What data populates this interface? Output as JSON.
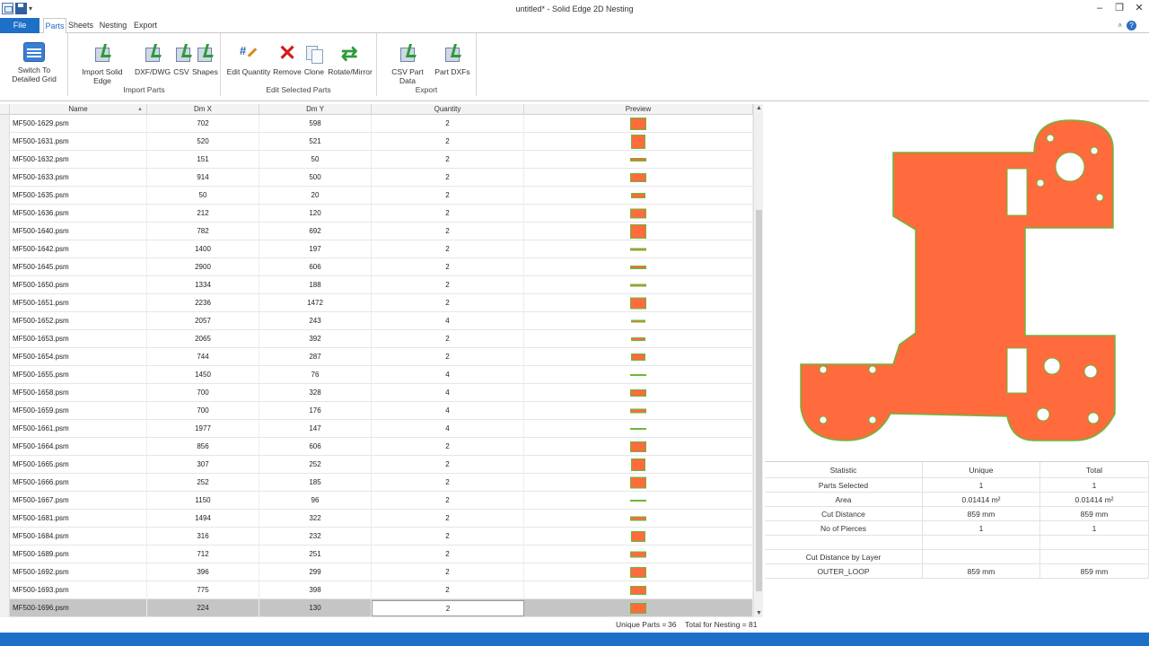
{
  "window": {
    "title": "untitled* - Solid Edge 2D Nesting",
    "minimize": "–",
    "maximize": "❐",
    "close": "✕"
  },
  "tabs": [
    {
      "label": "File"
    },
    {
      "label": "Parts"
    },
    {
      "label": "Sheets"
    },
    {
      "label": "Nesting"
    },
    {
      "label": "Export"
    }
  ],
  "help": "?",
  "collapse": "˄",
  "ribbon": {
    "groups": [
      {
        "label": "",
        "buttons": [
          {
            "label": "Switch To Detailed Grid"
          }
        ]
      },
      {
        "label": "Import Parts",
        "buttons": [
          {
            "label": "Import Solid Edge"
          },
          {
            "label": "DXF/DWG"
          },
          {
            "label": "CSV"
          },
          {
            "label": "Shapes"
          }
        ]
      },
      {
        "label": "Edit Selected Parts",
        "buttons": [
          {
            "label": "Edit Quantity"
          },
          {
            "label": "Remove"
          },
          {
            "label": "Clone"
          },
          {
            "label": "Rotate/Mirror"
          }
        ]
      },
      {
        "label": "Export",
        "buttons": [
          {
            "label": "CSV Part Data"
          },
          {
            "label": "Part DXFs"
          }
        ]
      }
    ]
  },
  "grid": {
    "columns": [
      "Name",
      "Dm X",
      "Dm Y",
      "Quantity",
      "Preview"
    ],
    "rows": [
      {
        "name": "MF500-1629.psm",
        "dx": "702",
        "dy": "598",
        "qty": "2"
      },
      {
        "name": "MF500-1631.psm",
        "dx": "520",
        "dy": "521",
        "qty": "2"
      },
      {
        "name": "MF500-1632.psm",
        "dx": "151",
        "dy": "50",
        "qty": "2"
      },
      {
        "name": "MF500-1633.psm",
        "dx": "914",
        "dy": "500",
        "qty": "2"
      },
      {
        "name": "MF500-1635.psm",
        "dx": "50",
        "dy": "20",
        "qty": "2"
      },
      {
        "name": "MF500-1636.psm",
        "dx": "212",
        "dy": "120",
        "qty": "2"
      },
      {
        "name": "MF500-1640.psm",
        "dx": "782",
        "dy": "692",
        "qty": "2"
      },
      {
        "name": "MF500-1642.psm",
        "dx": "1400",
        "dy": "197",
        "qty": "2"
      },
      {
        "name": "MF500-1645.psm",
        "dx": "2900",
        "dy": "606",
        "qty": "2"
      },
      {
        "name": "MF500-1650.psm",
        "dx": "1334",
        "dy": "188",
        "qty": "2"
      },
      {
        "name": "MF500-1651.psm",
        "dx": "2236",
        "dy": "1472",
        "qty": "2"
      },
      {
        "name": "MF500-1652.psm",
        "dx": "2057",
        "dy": "243",
        "qty": "4"
      },
      {
        "name": "MF500-1653.psm",
        "dx": "2065",
        "dy": "392",
        "qty": "2"
      },
      {
        "name": "MF500-1654.psm",
        "dx": "744",
        "dy": "287",
        "qty": "2"
      },
      {
        "name": "MF500-1655.psm",
        "dx": "1450",
        "dy": "76",
        "qty": "4"
      },
      {
        "name": "MF500-1658.psm",
        "dx": "700",
        "dy": "328",
        "qty": "4"
      },
      {
        "name": "MF500-1659.psm",
        "dx": "700",
        "dy": "176",
        "qty": "4"
      },
      {
        "name": "MF500-1661.psm",
        "dx": "1977",
        "dy": "147",
        "qty": "4"
      },
      {
        "name": "MF500-1664.psm",
        "dx": "856",
        "dy": "606",
        "qty": "2"
      },
      {
        "name": "MF500-1665.psm",
        "dx": "307",
        "dy": "252",
        "qty": "2"
      },
      {
        "name": "MF500-1666.psm",
        "dx": "252",
        "dy": "185",
        "qty": "2"
      },
      {
        "name": "MF500-1667.psm",
        "dx": "1150",
        "dy": "96",
        "qty": "2"
      },
      {
        "name": "MF500-1681.psm",
        "dx": "1494",
        "dy": "322",
        "qty": "2"
      },
      {
        "name": "MF500-1684.psm",
        "dx": "316",
        "dy": "232",
        "qty": "2"
      },
      {
        "name": "MF500-1689.psm",
        "dx": "712",
        "dy": "251",
        "qty": "2"
      },
      {
        "name": "MF500-1692.psm",
        "dx": "396",
        "dy": "299",
        "qty": "2"
      },
      {
        "name": "MF500-1693.psm",
        "dx": "775",
        "dy": "398",
        "qty": "2"
      },
      {
        "name": "MF500-1696.psm",
        "dx": "224",
        "dy": "130",
        "qty": "2",
        "selected": true
      }
    ]
  },
  "footer": {
    "unique_label": "Unique Parts  =",
    "unique_value": "36",
    "total_label": "Total for Nesting  =",
    "total_value": "81"
  },
  "stats": {
    "headers": [
      "Statistic",
      "Unique",
      "Total"
    ],
    "rows": [
      [
        "Parts Selected",
        "1",
        "1"
      ],
      [
        "Area",
        "0.01414 m²",
        "0.01414 m²"
      ],
      [
        "Cut Distance",
        "859 mm",
        "859 mm"
      ],
      [
        "No of Pierces",
        "1",
        "1"
      ],
      [
        "",
        "",
        ""
      ],
      [
        "Cut Distance by Layer",
        "",
        ""
      ],
      [
        "OUTER_LOOP",
        "859 mm",
        "859 mm"
      ]
    ]
  },
  "colors": {
    "part_fill": "#ff6b3d",
    "part_outline": "#6bb838",
    "accent": "#1e6fc7"
  }
}
